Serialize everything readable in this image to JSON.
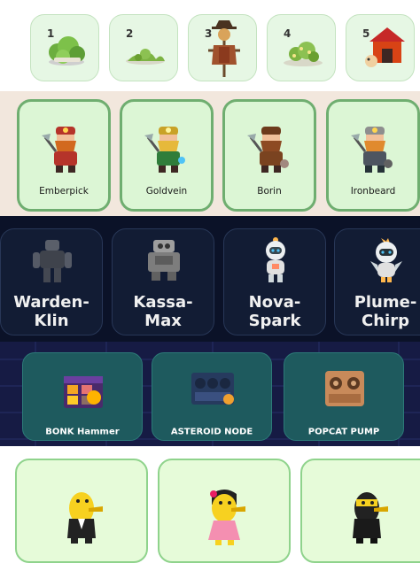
{
  "numbered_row": {
    "items": [
      {
        "number": "1",
        "icon": "bush-icon"
      },
      {
        "number": "2",
        "icon": "grass-tuft-icon"
      },
      {
        "number": "3",
        "icon": "scarecrow-icon"
      },
      {
        "number": "4",
        "icon": "flower-bush-icon"
      },
      {
        "number": "5",
        "icon": "doghouse-icon"
      }
    ]
  },
  "dwarves": {
    "items": [
      {
        "name": "Emberpick",
        "icon": "red-dwarf-miner-icon",
        "color": "#b5342a"
      },
      {
        "name": "Goldvein",
        "icon": "green-dwarf-miner-icon",
        "color": "#2f7d3a"
      },
      {
        "name": "Borin",
        "icon": "brown-dwarf-miner-icon",
        "color": "#7a4320"
      },
      {
        "name": "Ironbeard",
        "icon": "grey-dwarf-miner-icon",
        "color": "#4d5560"
      }
    ]
  },
  "robots": {
    "items": [
      {
        "name": "Warden-\nKlin",
        "icon": "dark-mech-robot-icon"
      },
      {
        "name": "Kassa-\nMax",
        "icon": "gray-boxy-robot-icon"
      },
      {
        "name": "Nova-\nSpark",
        "icon": "white-astronaut-robot-icon"
      },
      {
        "name": "Plume-\nChirp",
        "icon": "white-bird-robot-icon"
      }
    ]
  },
  "machines": {
    "items": [
      {
        "name": "BONK Hammer",
        "icon": "purple-loot-crate-icon"
      },
      {
        "name": "ASTEROID NODE",
        "icon": "blue-mining-rig-icon"
      },
      {
        "name": "POPCAT PUMP",
        "icon": "copper-mining-rig-icon"
      }
    ]
  },
  "ducks": {
    "items": [
      {
        "icon": "duck-tuxedo-icon"
      },
      {
        "icon": "duck-pink-dress-icon"
      },
      {
        "icon": "duck-ninja-icon"
      }
    ]
  },
  "colors": {
    "green_card": "#dcf6d5",
    "green_border": "#6fae70",
    "navy_bg": "#0b1228",
    "teal_card": "#1e5a5e"
  }
}
